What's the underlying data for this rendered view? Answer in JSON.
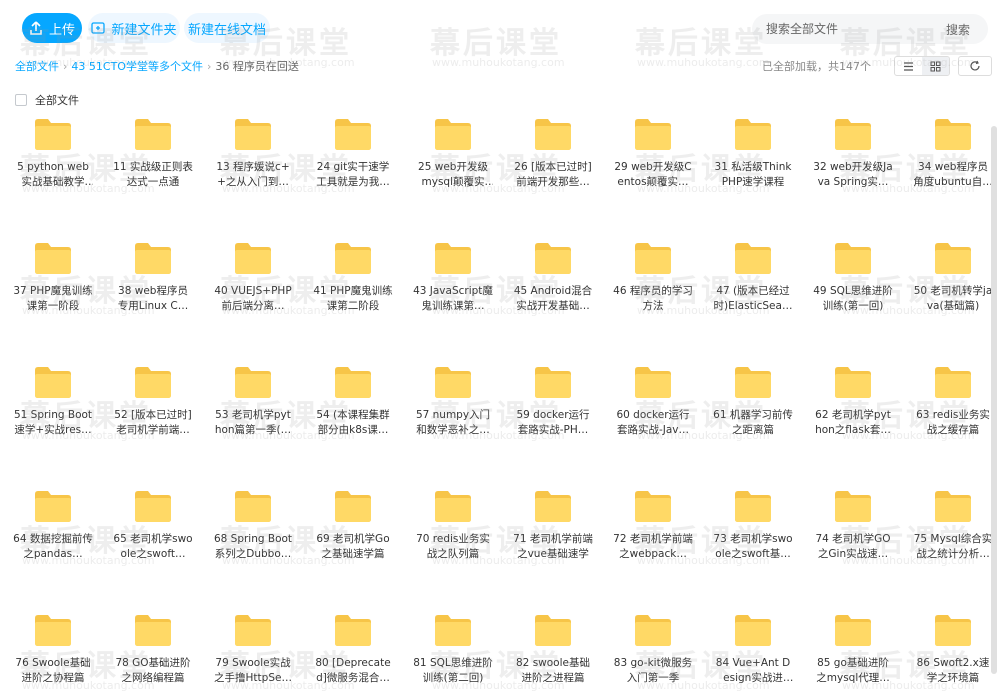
{
  "toolbar": {
    "upload_label": "上传",
    "new_folder_label": "新建文件夹",
    "new_doc_label": "新建在线文档"
  },
  "search": {
    "placeholder": "搜索全部文件",
    "button_label": "搜索"
  },
  "breadcrumb": {
    "root": "全部文件",
    "parent": "43 51CTO学堂等多个文件",
    "current": "36 程序员在回送"
  },
  "status": {
    "load_text": "已全部加载，共147个"
  },
  "select_all_label": "全部文件",
  "watermark": {
    "text": "幕后课堂",
    "url": "www.muhoukotang.com"
  },
  "colors": {
    "accent": "#06a7ff",
    "folder_back": "#f7c548",
    "folder_front": "#ffd966"
  },
  "icons": {
    "upload": "upload-icon",
    "new_folder": "new-folder-icon",
    "list_view": "list-view-icon",
    "grid_view": "grid-view-icon",
    "refresh": "refresh-icon",
    "folder": "folder-icon"
  },
  "folders": [
    "5 python web实战基础教学第…",
    "11 实战级正则表达式一点通",
    "13 程序媛说c++之从入门到…",
    "24 git实干速学工具就是为我…",
    "25 web开发级mysql颠覆实战…",
    "26 [版本已过时]前端开发那些…",
    "29 web开发级Centos颠覆实…",
    "31 私活级ThinkPHP速学课程",
    "32 web开发级Java Spring实…",
    "34 web程序员角度ubuntu自…",
    "37 PHP魔鬼训练课第一阶段",
    "38 web程序员专用Linux C…",
    "40 VUEJS+PHP前后端分离…",
    "41 PHP魔鬼训练课第二阶段",
    "43 JavaScript魔鬼训练课第…",
    "45 Android混合实战开发基础…",
    "46 程序员的学习方法",
    "47 (版本已经过时)ElasticSea…",
    "49 SQL思维进阶训练(第一回)",
    "50 老司机转学java(基础篇)",
    "51 Spring Boot速学+实战res…",
    "52 [版本已过时]老司机学前端…",
    "53 老司机学python篇第一季(…",
    "54 (本课程集群部分由k8s课…",
    "57 numpy入门和数学恶补之…",
    "59 docker运行套路实战-PH…",
    "60 docker运行套路实战-Jav…",
    "61 机器学习前传之距离篇",
    "62 老司机学python之flask套…",
    "63 redis业务实战之缓存篇",
    "64 数据挖掘前传之pandas…",
    "65 老司机学swoole之swoft…",
    "68 Spring Boot系列之Dubbo…",
    "69 老司机学Go之基础速学篇",
    "70 redis业务实战之队列篇",
    "71 老司机学前端之vue基础速学",
    "72 老司机学前端之webpack…",
    "73 老司机学swoole之swoft基…",
    "74 老司机学GO之Gin实战速…",
    "75 Mysql综合实战之统计分析…",
    "76 Swoole基础进阶之协程篇",
    "78 GO基础进阶之网络编程篇",
    "79 Swoole实战之手撸HttpSe…",
    "80 [Deprecated]微服务混合…",
    "81 SQL思维进阶训练(第二回)",
    "82 swoole基础进阶之进程篇",
    "83 go-kit微服务入门第一季",
    "84 Vue+Ant Design实战进阶…",
    "85 go基础进阶之mysql代理…",
    "86 Swoft2.x速学之环境篇"
  ]
}
